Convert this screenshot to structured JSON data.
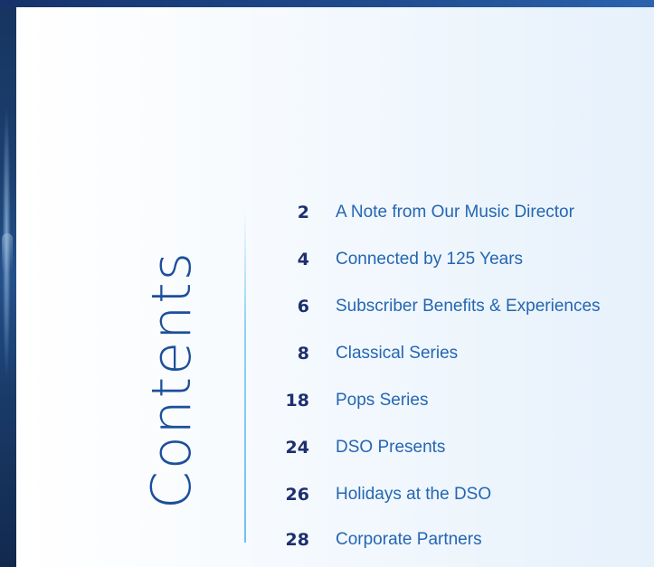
{
  "heading": "Contents",
  "toc": [
    {
      "page": "2",
      "title": "A Note from Our Music Director"
    },
    {
      "page": "4",
      "title": "Connected by 125 Years"
    },
    {
      "page": "6",
      "title": "Subscriber Benefits & Experiences"
    },
    {
      "page": "8",
      "title": "Classical Series"
    },
    {
      "page": "18",
      "title": "Pops Series"
    },
    {
      "page": "24",
      "title": "DSO Presents"
    },
    {
      "page": "26",
      "title": "Holidays at the DSO"
    },
    {
      "page": "28",
      "title": "Corporate Partners"
    }
  ],
  "colors": {
    "heading": "#1c4f9c",
    "page_number": "#1c2f70",
    "title": "#2466b2",
    "divider": "#8fd3f0",
    "top_band": "#1f4a8c"
  }
}
